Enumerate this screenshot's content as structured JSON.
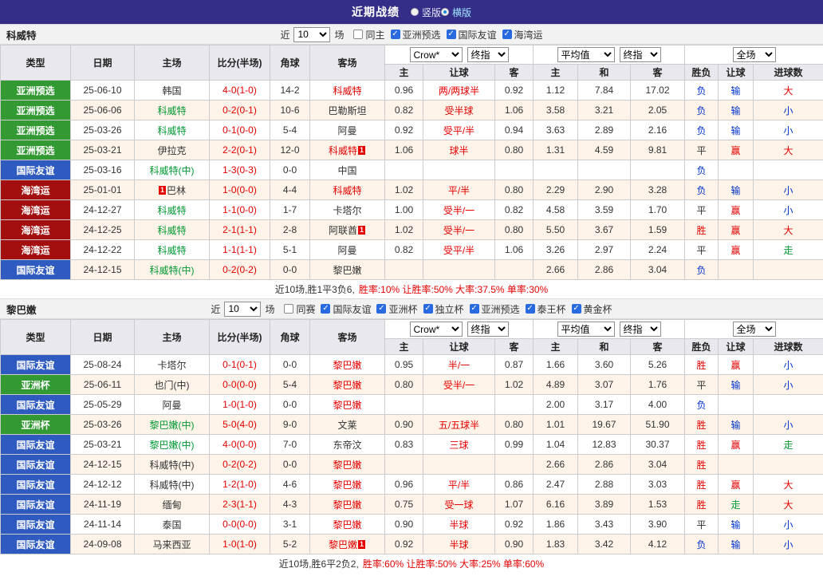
{
  "topbar": {
    "title": "近期战绩",
    "radios": [
      {
        "label": "竖版",
        "selected": false
      },
      {
        "label": "横版",
        "selected": true
      }
    ]
  },
  "table_header": {
    "main_cols": [
      "类型",
      "日期",
      "主场",
      "比分(半场)",
      "角球",
      "客场"
    ],
    "odds_selects": [
      "Crow*",
      "终指"
    ],
    "avg_selects": [
      "平均值",
      "终指"
    ],
    "full_select": "全场",
    "sub_cols": [
      "主",
      "让球",
      "客",
      "主",
      "和",
      "客",
      "胜负",
      "让球",
      "进球数"
    ]
  },
  "type_colors": {
    "亚洲预选": "green",
    "国际友谊": "blue",
    "海湾运": "darkred",
    "亚洲杯": "green"
  },
  "result_colors": {
    "胜": "red",
    "平": "black",
    "负": "blue",
    "赢": "red",
    "输": "blue",
    "走": "green",
    "大": "red",
    "小": "blue"
  },
  "sections": [
    {
      "team": "科威特",
      "filter": {
        "near": "近",
        "count": "10",
        "games": "场",
        "checkboxes": [
          {
            "label": "同主",
            "checked": false
          },
          {
            "label": "亚洲预选",
            "checked": true
          },
          {
            "label": "国际友谊",
            "checked": true
          },
          {
            "label": "海湾运",
            "checked": true
          }
        ]
      },
      "rows": [
        {
          "type": "亚洲预选",
          "date": "25-06-10",
          "home": "韩国",
          "home_color": "black",
          "home_badge": "",
          "score": "4-0(1-0)",
          "corner": "14-2",
          "away": "科威特",
          "away_color": "red",
          "away_badge": "",
          "odds": [
            "0.96",
            "两/两球半",
            "0.92"
          ],
          "avg": [
            "1.12",
            "7.84",
            "17.02"
          ],
          "results": [
            "负",
            "输",
            "大"
          ]
        },
        {
          "type": "亚洲预选",
          "date": "25-06-06",
          "home": "科威特",
          "home_color": "green",
          "home_badge": "",
          "score": "0-2(0-1)",
          "corner": "10-6",
          "away": "巴勒斯坦",
          "away_color": "black",
          "away_badge": "",
          "odds": [
            "0.82",
            "受半球",
            "1.06"
          ],
          "avg": [
            "3.58",
            "3.21",
            "2.05"
          ],
          "results": [
            "负",
            "输",
            "小"
          ]
        },
        {
          "type": "亚洲预选",
          "date": "25-03-26",
          "home": "科威特",
          "home_color": "green",
          "home_badge": "",
          "score": "0-1(0-0)",
          "corner": "5-4",
          "away": "阿曼",
          "away_color": "black",
          "away_badge": "",
          "odds": [
            "0.92",
            "受平/半",
            "0.94"
          ],
          "avg": [
            "3.63",
            "2.89",
            "2.16"
          ],
          "results": [
            "负",
            "输",
            "小"
          ]
        },
        {
          "type": "亚洲预选",
          "date": "25-03-21",
          "home": "伊拉克",
          "home_color": "black",
          "home_badge": "",
          "score": "2-2(0-1)",
          "corner": "12-0",
          "away": "科威特",
          "away_color": "red",
          "away_badge": "1",
          "odds": [
            "1.06",
            "球半",
            "0.80"
          ],
          "avg": [
            "1.31",
            "4.59",
            "9.81"
          ],
          "results": [
            "平",
            "赢",
            "大"
          ]
        },
        {
          "type": "国际友谊",
          "date": "25-03-16",
          "home": "科威特(中)",
          "home_color": "green",
          "home_badge": "",
          "score": "1-3(0-3)",
          "corner": "0-0",
          "away": "中国",
          "away_color": "black",
          "away_badge": "",
          "odds": [
            "",
            "",
            ""
          ],
          "avg": [
            "",
            "",
            ""
          ],
          "results": [
            "负",
            "",
            ""
          ]
        },
        {
          "type": "海湾运",
          "date": "25-01-01",
          "home": "巴林",
          "home_color": "black",
          "home_badge": "1",
          "score": "1-0(0-0)",
          "corner": "4-4",
          "away": "科威特",
          "away_color": "red",
          "away_badge": "",
          "odds": [
            "1.02",
            "平/半",
            "0.80"
          ],
          "avg": [
            "2.29",
            "2.90",
            "3.28"
          ],
          "results": [
            "负",
            "输",
            "小"
          ]
        },
        {
          "type": "海湾运",
          "date": "24-12-27",
          "home": "科威特",
          "home_color": "green",
          "home_badge": "",
          "score": "1-1(0-0)",
          "corner": "1-7",
          "away": "卡塔尔",
          "away_color": "black",
          "away_badge": "",
          "odds": [
            "1.00",
            "受半/一",
            "0.82"
          ],
          "avg": [
            "4.58",
            "3.59",
            "1.70"
          ],
          "results": [
            "平",
            "赢",
            "小"
          ]
        },
        {
          "type": "海湾运",
          "date": "24-12-25",
          "home": "科威特",
          "home_color": "green",
          "home_badge": "",
          "score": "2-1(1-1)",
          "corner": "2-8",
          "away": "阿联酋",
          "away_color": "black",
          "away_badge": "1",
          "odds": [
            "1.02",
            "受半/一",
            "0.80"
          ],
          "avg": [
            "5.50",
            "3.67",
            "1.59"
          ],
          "results": [
            "胜",
            "赢",
            "大"
          ]
        },
        {
          "type": "海湾运",
          "date": "24-12-22",
          "home": "科威特",
          "home_color": "green",
          "home_badge": "",
          "score": "1-1(1-1)",
          "corner": "5-1",
          "away": "阿曼",
          "away_color": "black",
          "away_badge": "",
          "odds": [
            "0.82",
            "受平/半",
            "1.06"
          ],
          "avg": [
            "3.26",
            "2.97",
            "2.24"
          ],
          "results": [
            "平",
            "赢",
            "走"
          ]
        },
        {
          "type": "国际友谊",
          "date": "24-12-15",
          "home": "科威特(中)",
          "home_color": "green",
          "home_badge": "",
          "score": "0-2(0-2)",
          "corner": "0-0",
          "away": "黎巴嫩",
          "away_color": "black",
          "away_badge": "",
          "odds": [
            "",
            "",
            ""
          ],
          "avg": [
            "2.66",
            "2.86",
            "3.04"
          ],
          "results": [
            "负",
            "",
            ""
          ]
        }
      ],
      "summary": {
        "prefix": "近10场,胜1平3负6,",
        "stats": "胜率:10% 让胜率:50% 大率:37.5% 单率:30%"
      }
    },
    {
      "team": "黎巴嫩",
      "filter": {
        "near": "近",
        "count": "10",
        "games": "场",
        "checkboxes": [
          {
            "label": "同赛",
            "checked": false
          },
          {
            "label": "国际友谊",
            "checked": true
          },
          {
            "label": "亚洲杯",
            "checked": true
          },
          {
            "label": "独立杯",
            "checked": true
          },
          {
            "label": "亚洲预选",
            "checked": true
          },
          {
            "label": "泰王杯",
            "checked": true
          },
          {
            "label": "黄金杯",
            "checked": true
          }
        ]
      },
      "rows": [
        {
          "type": "国际友谊",
          "date": "25-08-24",
          "home": "卡塔尔",
          "home_color": "black",
          "home_badge": "",
          "score": "0-1(0-1)",
          "corner": "0-0",
          "away": "黎巴嫩",
          "away_color": "red",
          "away_badge": "",
          "odds": [
            "0.95",
            "半/一",
            "0.87"
          ],
          "avg": [
            "1.66",
            "3.60",
            "5.26"
          ],
          "results": [
            "胜",
            "赢",
            "小"
          ]
        },
        {
          "type": "亚洲杯",
          "date": "25-06-11",
          "home": "也门(中)",
          "home_color": "black",
          "home_badge": "",
          "score": "0-0(0-0)",
          "corner": "5-4",
          "away": "黎巴嫩",
          "away_color": "red",
          "away_badge": "",
          "odds": [
            "0.80",
            "受半/一",
            "1.02"
          ],
          "avg": [
            "4.89",
            "3.07",
            "1.76"
          ],
          "results": [
            "平",
            "输",
            "小"
          ]
        },
        {
          "type": "国际友谊",
          "date": "25-05-29",
          "home": "阿曼",
          "home_color": "black",
          "home_badge": "",
          "score": "1-0(1-0)",
          "corner": "0-0",
          "away": "黎巴嫩",
          "away_color": "red",
          "away_badge": "",
          "odds": [
            "",
            "",
            ""
          ],
          "avg": [
            "2.00",
            "3.17",
            "4.00"
          ],
          "results": [
            "负",
            "",
            ""
          ]
        },
        {
          "type": "亚洲杯",
          "date": "25-03-26",
          "home": "黎巴嫩(中)",
          "home_color": "green",
          "home_badge": "",
          "score": "5-0(4-0)",
          "corner": "9-0",
          "away": "文莱",
          "away_color": "black",
          "away_badge": "",
          "odds": [
            "0.90",
            "五/五球半",
            "0.80"
          ],
          "avg": [
            "1.01",
            "19.67",
            "51.90"
          ],
          "results": [
            "胜",
            "输",
            "小"
          ]
        },
        {
          "type": "国际友谊",
          "date": "25-03-21",
          "home": "黎巴嫩(中)",
          "home_color": "green",
          "home_badge": "",
          "score": "4-0(0-0)",
          "corner": "7-0",
          "away": "东帝汶",
          "away_color": "black",
          "away_badge": "",
          "odds": [
            "0.83",
            "三球",
            "0.99"
          ],
          "avg": [
            "1.04",
            "12.83",
            "30.37"
          ],
          "results": [
            "胜",
            "赢",
            "走"
          ]
        },
        {
          "type": "国际友谊",
          "date": "24-12-15",
          "home": "科威特(中)",
          "home_color": "black",
          "home_badge": "",
          "score": "0-2(0-2)",
          "corner": "0-0",
          "away": "黎巴嫩",
          "away_color": "red",
          "away_badge": "",
          "odds": [
            "",
            "",
            ""
          ],
          "avg": [
            "2.66",
            "2.86",
            "3.04"
          ],
          "results": [
            "胜",
            "",
            ""
          ]
        },
        {
          "type": "国际友谊",
          "date": "24-12-12",
          "home": "科威特(中)",
          "home_color": "black",
          "home_badge": "",
          "score": "1-2(1-0)",
          "corner": "4-6",
          "away": "黎巴嫩",
          "away_color": "red",
          "away_badge": "",
          "odds": [
            "0.96",
            "平/半",
            "0.86"
          ],
          "avg": [
            "2.47",
            "2.88",
            "3.03"
          ],
          "results": [
            "胜",
            "赢",
            "大"
          ]
        },
        {
          "type": "国际友谊",
          "date": "24-11-19",
          "home": "缅甸",
          "home_color": "black",
          "home_badge": "",
          "score": "2-3(1-1)",
          "corner": "4-3",
          "away": "黎巴嫩",
          "away_color": "red",
          "away_badge": "",
          "odds": [
            "0.75",
            "受一球",
            "1.07"
          ],
          "avg": [
            "6.16",
            "3.89",
            "1.53"
          ],
          "results": [
            "胜",
            "走",
            "大"
          ]
        },
        {
          "type": "国际友谊",
          "date": "24-11-14",
          "home": "泰国",
          "home_color": "black",
          "home_badge": "",
          "score": "0-0(0-0)",
          "corner": "3-1",
          "away": "黎巴嫩",
          "away_color": "red",
          "away_badge": "",
          "odds": [
            "0.90",
            "半球",
            "0.92"
          ],
          "avg": [
            "1.86",
            "3.43",
            "3.90"
          ],
          "results": [
            "平",
            "输",
            "小"
          ]
        },
        {
          "type": "国际友谊",
          "date": "24-09-08",
          "home": "马来西亚",
          "home_color": "black",
          "home_badge": "",
          "score": "1-0(1-0)",
          "corner": "5-2",
          "away": "黎巴嫩",
          "away_color": "red",
          "away_badge": "1",
          "odds": [
            "0.92",
            "半球",
            "0.90"
          ],
          "avg": [
            "1.83",
            "3.42",
            "4.12"
          ],
          "results": [
            "负",
            "输",
            "小"
          ]
        }
      ],
      "summary": {
        "prefix": "近10场,胜6平2负2,",
        "stats": "胜率:60% 让胜率:50% 大率:25% 单率:60%"
      }
    }
  ]
}
